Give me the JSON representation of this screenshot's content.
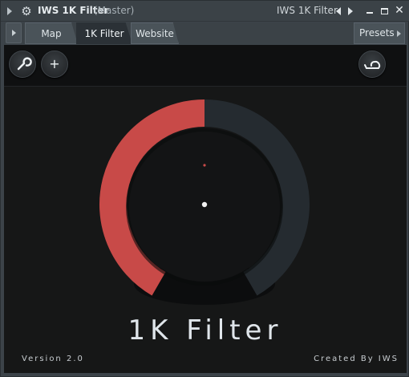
{
  "titlebar": {
    "title": "IWS 1K Filter",
    "host": "(Master)",
    "right_label": "IWS 1K Filter",
    "gear_icon": "gear-icon"
  },
  "tabs": {
    "items": [
      {
        "label": "Map"
      },
      {
        "label": "1K Filter"
      },
      {
        "label": "Website"
      }
    ],
    "active": "1K Filter",
    "presets_label": "Presets"
  },
  "toolbar": {
    "wrench_icon": "wrench-icon",
    "add_label": "+",
    "snail_icon": "snail-icon"
  },
  "knob": {
    "value_fraction": 0.5,
    "active_color": "#c84a48",
    "track_color": "#252b30"
  },
  "main": {
    "title": "1K Filter",
    "version": "Version 2.0",
    "credit": "Created By IWS"
  }
}
